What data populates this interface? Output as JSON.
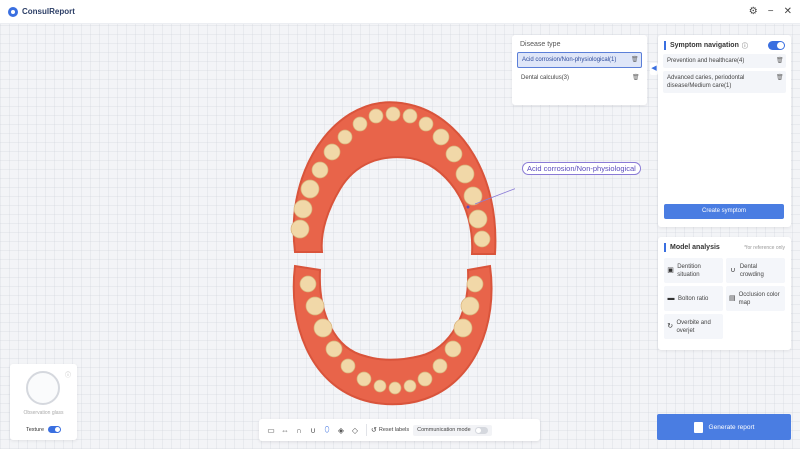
{
  "app": {
    "title": "ConsulReport"
  },
  "window_controls": {
    "settings_icon": "gear-icon",
    "minimize": "−",
    "close": "✕"
  },
  "disease_panel": {
    "title": "Disease type",
    "items": [
      {
        "label": "Acid corrosion/Non-physiological(1)",
        "selected": true
      },
      {
        "label": "Dental calculus(3)",
        "selected": false
      }
    ]
  },
  "callout": {
    "label": "Acid corrosion/Non-physiological"
  },
  "symptom_panel": {
    "title": "Symptom navigation",
    "enabled": true,
    "items": [
      {
        "label": "Prevention and healthcare(4)"
      },
      {
        "label": "Advanced caries, periodontal disease/Medium care(1)"
      }
    ],
    "create_button": "Create symptom"
  },
  "model_panel": {
    "title": "Model analysis",
    "note": "*for reference only",
    "items": [
      {
        "label": "Dentition situation",
        "icon": "dentition-icon"
      },
      {
        "label": "Dental crowding",
        "icon": "crowding-icon"
      },
      {
        "label": "Bolton ratio",
        "icon": "ratio-icon"
      },
      {
        "label": "Occlusion color map",
        "icon": "occlusion-icon"
      },
      {
        "label": "Overbite and overjet",
        "icon": "overbite-icon"
      }
    ]
  },
  "generate_button": "Generate report",
  "observation": {
    "label": "Observation glass",
    "texture_label": "Texture",
    "texture_on": true
  },
  "toolbar": {
    "reset_label": "Reset labels",
    "comm_label": "Communication mode",
    "comm_on": false
  },
  "colors": {
    "accent": "#3a6fe0",
    "gum": "#e8644a",
    "tooth": "#f1d8a8"
  }
}
